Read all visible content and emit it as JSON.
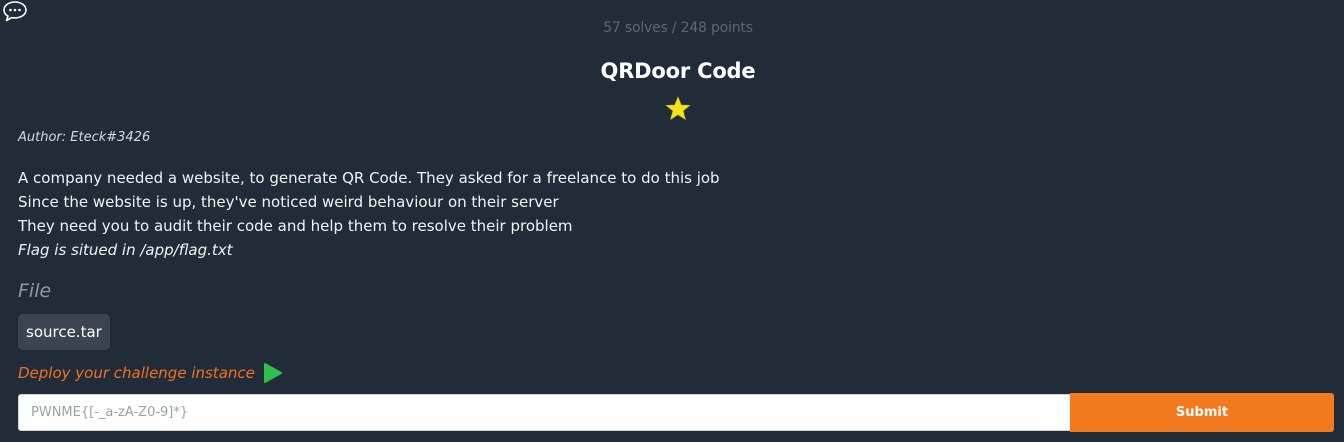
{
  "header": {
    "solves_text": "57 solves / 248 points",
    "title": "QRDoor Code"
  },
  "challenge": {
    "author": "Author: Eteck#3426",
    "description": [
      "A company needed a website, to generate QR Code. They asked for a freelance to do this job",
      "Since the website is up, they've noticed weird behaviour on their server",
      "They need you to audit their code and help them to resolve their problem"
    ],
    "note": "Flag is situed in /app/flag.txt",
    "difficulty_stars": 1
  },
  "files": {
    "heading": "File",
    "items": [
      "source.tar"
    ]
  },
  "deploy": {
    "label": "Deploy your challenge instance",
    "icon": "play-icon"
  },
  "form": {
    "placeholder": "PWNME{[-_a-zA-Z0-9]*}",
    "value": "",
    "submit_label": "Submit"
  },
  "colors": {
    "background": "#222b38",
    "accent": "#f47a20",
    "star": "#f4e21a",
    "play": "#2fbf4a",
    "deploy_text": "#f07224"
  },
  "icons": {
    "chat": "chat-bubble-icon",
    "star": "star-icon",
    "deploy": "play-icon"
  }
}
